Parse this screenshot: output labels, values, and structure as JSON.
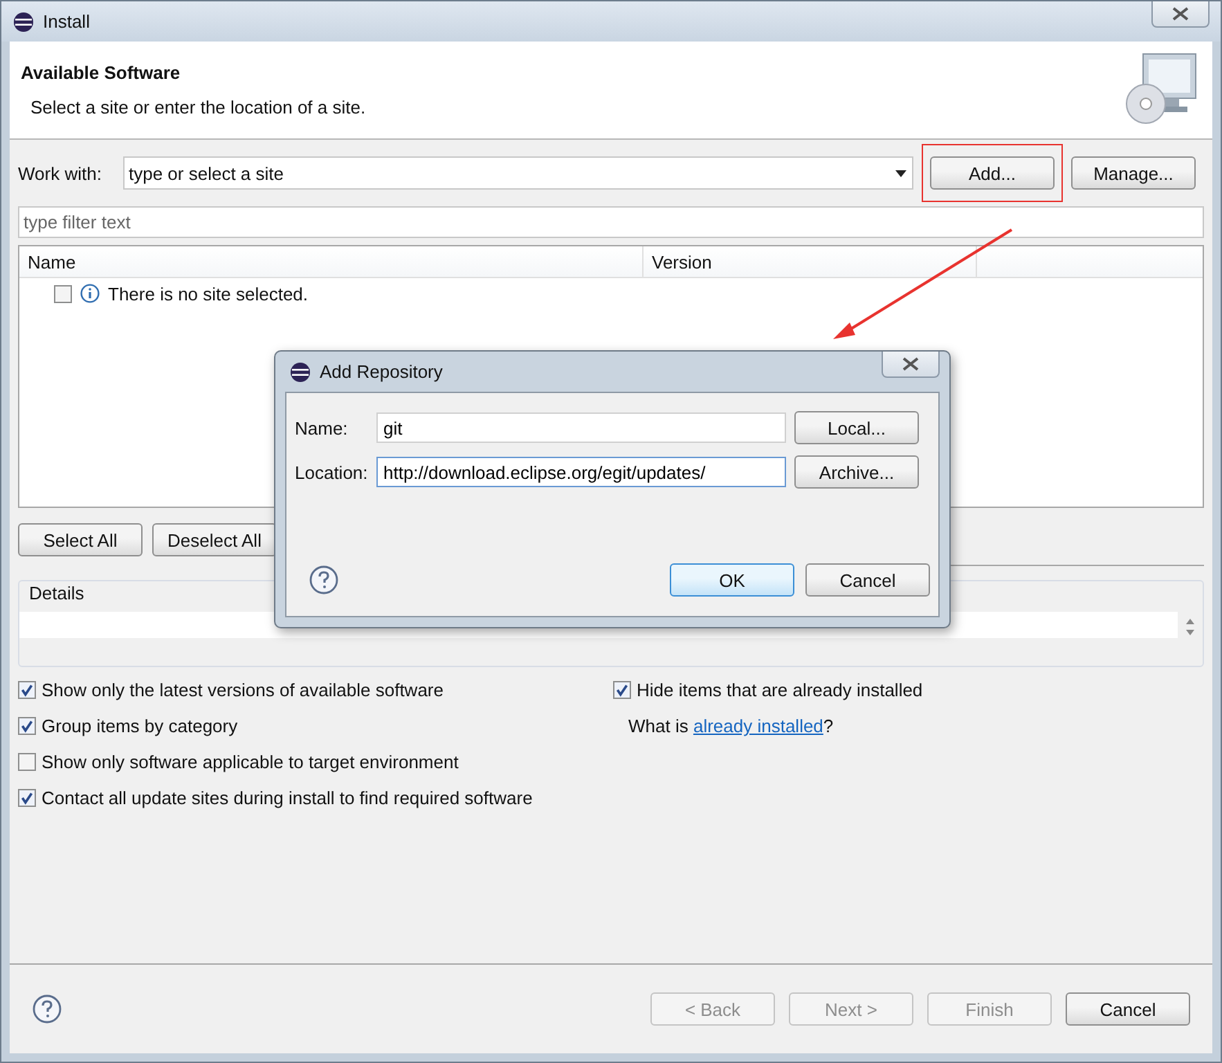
{
  "window": {
    "title": "Install"
  },
  "header": {
    "title": "Available Software",
    "subtitle": "Select a site or enter the location of a site."
  },
  "work_with": {
    "label": "Work with:",
    "placeholder": "type or select a site",
    "buttons": [
      {
        "label": "Add...",
        "highlighted": true
      },
      {
        "label": "Manage...",
        "highlighted": false
      }
    ]
  },
  "filter": {
    "placeholder": "type filter text"
  },
  "table": {
    "columns": [
      "Name",
      "Version"
    ],
    "rows": [
      {
        "checked": false,
        "text": "There is no site selected."
      }
    ]
  },
  "selection_buttons": [
    "Select All",
    "Deselect All"
  ],
  "details": {
    "label": "Details"
  },
  "options_left": [
    {
      "label": "Show only the latest versions of available software",
      "checked": true
    },
    {
      "label": "Group items by category",
      "checked": true
    },
    {
      "label": "Show only software applicable to target environment",
      "checked": false
    },
    {
      "label": "Contact all update sites during install to find required software",
      "checked": true
    }
  ],
  "options_right": [
    {
      "label": "Hide items that are already installed",
      "checked": true
    }
  ],
  "installed_note": {
    "prefix": "What is ",
    "link": "already installed",
    "suffix": "?"
  },
  "wizard_buttons": [
    {
      "label": "< Back",
      "disabled": true
    },
    {
      "label": "Next >",
      "disabled": true
    },
    {
      "label": "Finish",
      "disabled": true
    },
    {
      "label": "Cancel",
      "disabled": false
    }
  ],
  "dialog": {
    "title": "Add Repository",
    "fields": [
      {
        "label": "Name:",
        "value": "git",
        "button": "Local..."
      },
      {
        "label": "Location:",
        "value": "http://download.eclipse.org/egit/updates/",
        "button": "Archive..."
      }
    ],
    "buttons": [
      {
        "label": "OK",
        "default": true
      },
      {
        "label": "Cancel",
        "default": false
      }
    ]
  }
}
